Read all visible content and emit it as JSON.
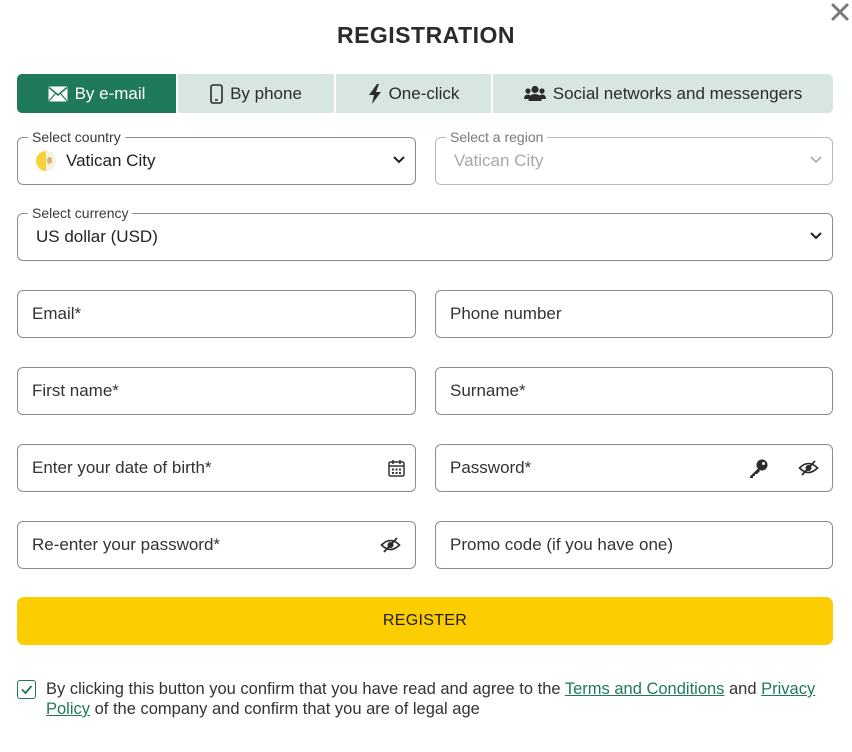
{
  "title": "REGISTRATION",
  "tabs": [
    {
      "label": "By e-mail",
      "icon": "envelope-icon",
      "active": true
    },
    {
      "label": "By phone",
      "icon": "phone-icon",
      "active": false
    },
    {
      "label": "One-click",
      "icon": "lightning-icon",
      "active": false
    },
    {
      "label": "Social networks and messengers",
      "icon": "users-icon",
      "active": false
    }
  ],
  "country": {
    "label": "Select country",
    "value": "Vatican City",
    "icon": "vatican-flag-icon"
  },
  "region": {
    "label": "Select a region",
    "value": "Vatican City",
    "disabled": true
  },
  "currency": {
    "label": "Select currency",
    "value": "US dollar (USD)"
  },
  "fields": {
    "email": "Email*",
    "phone": "Phone number",
    "first_name": "First name*",
    "surname": "Surname*",
    "dob": "Enter your date of birth*",
    "password": "Password*",
    "repassword": "Re-enter your password*",
    "promo": "Promo code (if you have one)"
  },
  "register_label": "REGISTER",
  "consent": {
    "checked": true,
    "text_before": "By clicking this button you confirm that you have read and agree to the ",
    "terms_link": "Terms and Conditions",
    "text_and": " and ",
    "privacy_link": "Privacy Policy",
    "text_after": " of the company and confirm that you are of legal age"
  },
  "colors": {
    "brand_green": "#1e7a58",
    "tab_background": "#d7e7df",
    "register_yellow": "#fccd00"
  }
}
